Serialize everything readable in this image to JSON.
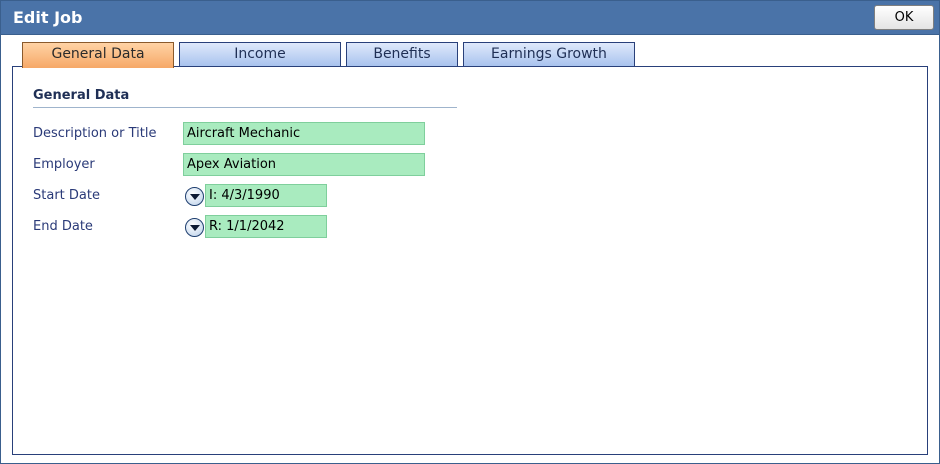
{
  "window": {
    "title": "Edit Job",
    "ok_label": "OK"
  },
  "tabs": [
    {
      "label": "General Data",
      "active": true
    },
    {
      "label": "Income",
      "active": false
    },
    {
      "label": "Benefits",
      "active": false
    },
    {
      "label": "Earnings Growth",
      "active": false
    }
  ],
  "section": {
    "title": "General Data"
  },
  "fields": {
    "description": {
      "label": "Description or Title",
      "value": "Aircraft Mechanic"
    },
    "employer": {
      "label": "Employer",
      "value": "Apex Aviation"
    },
    "start_date": {
      "label": "Start Date",
      "value": "I: 4/3/1990",
      "dropdown_icon": "chevron-down-icon"
    },
    "end_date": {
      "label": "End Date",
      "value": "R: 1/1/2042",
      "dropdown_icon": "chevron-down-icon"
    }
  },
  "colors": {
    "titlebar": "#4a73a8",
    "tab_active": "#f6a867",
    "tab_inactive": "#a9c3ee",
    "field_bg": "#a9ebbf",
    "label_text": "#2a3a78"
  }
}
